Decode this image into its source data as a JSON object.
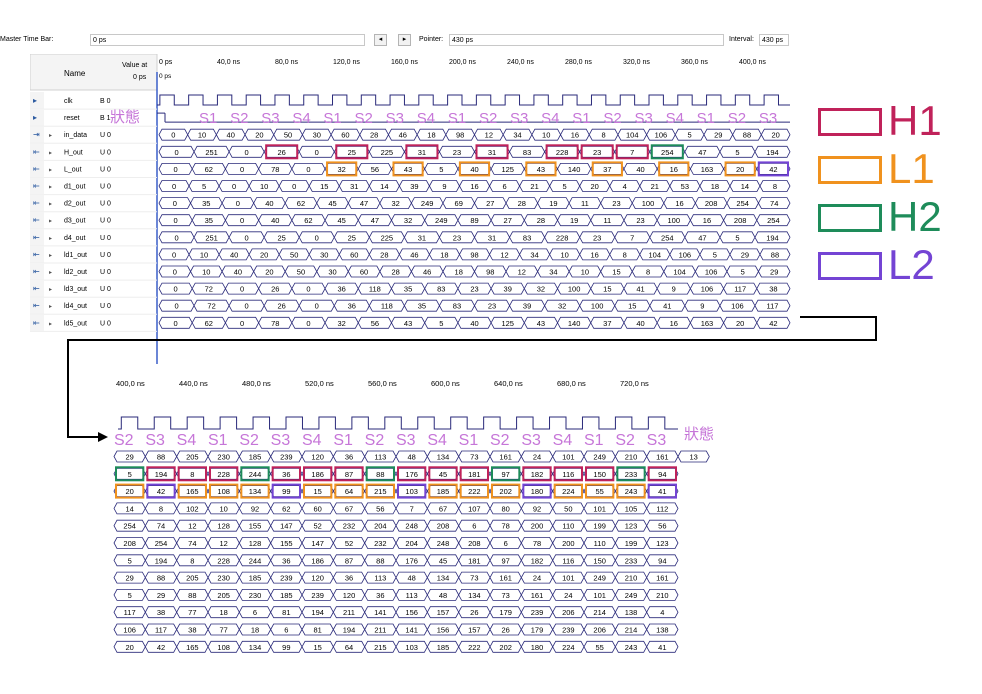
{
  "top_bar": {
    "master_time_bar_label": "Master Time Bar:",
    "master_time_bar_value": "0 ps",
    "pointer_label": "Pointer:",
    "pointer_value": "430 ps",
    "interval_label": "Interval:",
    "interval_value": "430 ps",
    "nav_prev": "◂",
    "nav_next": "▸"
  },
  "main_panel": {
    "name_header": "Name",
    "value_header": "Value at",
    "value_header_sub": "0 ps",
    "cursor_label": "0 ps",
    "time_labels": [
      "0 ps",
      "40,0 ns",
      "80,0 ns",
      "120,0 ns",
      "160,0 ns",
      "200,0 ns",
      "240,0 ns",
      "280,0 ns",
      "320,0 ns",
      "360,0 ns",
      "400,0 ns",
      "4"
    ],
    "signals": [
      {
        "name": "clk",
        "value": "B 0",
        "type": "input",
        "expand": false
      },
      {
        "name": "reset",
        "value": "B 1",
        "type": "input",
        "expand": false
      },
      {
        "name": "in_data",
        "value": "U 0",
        "type": "bus-in",
        "expand": true
      },
      {
        "name": "H_out",
        "value": "U 0",
        "type": "bus-out",
        "expand": true
      },
      {
        "name": "L_out",
        "value": "U 0",
        "type": "bus-out",
        "expand": true
      },
      {
        "name": "d1_out",
        "value": "U 0",
        "type": "bus-out",
        "expand": true
      },
      {
        "name": "d2_out",
        "value": "U 0",
        "type": "bus-out",
        "expand": true
      },
      {
        "name": "d3_out",
        "value": "U 0",
        "type": "bus-out",
        "expand": true
      },
      {
        "name": "d4_out",
        "value": "U 0",
        "type": "bus-out",
        "expand": true
      },
      {
        "name": "ld1_out",
        "value": "U 0",
        "type": "bus-out",
        "expand": true
      },
      {
        "name": "ld2_out",
        "value": "U 0",
        "type": "bus-out",
        "expand": true
      },
      {
        "name": "ld3_out",
        "value": "U 0",
        "type": "bus-out",
        "expand": true
      },
      {
        "name": "ld4_out",
        "value": "U 0",
        "type": "bus-out",
        "expand": true
      },
      {
        "name": "ld5_out",
        "value": "U 0",
        "type": "bus-out",
        "expand": true
      }
    ],
    "state_label_text": "狀態",
    "state_sequence": [
      "S1",
      "S2",
      "S3",
      "S4",
      "S1",
      "S2",
      "S3",
      "S4",
      "S1",
      "S2",
      "S3",
      "S4",
      "S1",
      "S2",
      "S3",
      "S4",
      "S1",
      "S2",
      "S3"
    ],
    "bus_rows": [
      [
        "0",
        "10",
        "40",
        "20",
        "50",
        "30",
        "60",
        "28",
        "46",
        "18",
        "98",
        "12",
        "34",
        "10",
        "16",
        "8",
        "104",
        "106",
        "5",
        "29",
        "88",
        "20"
      ],
      [
        "0",
        "251",
        "0",
        "26",
        "0",
        "25",
        "225",
        "31",
        "23",
        "31",
        "83",
        "228",
        "23",
        "7",
        "254",
        "47",
        "5",
        "194"
      ],
      [
        "0",
        "62",
        "0",
        "78",
        "0",
        "32",
        "56",
        "43",
        "5",
        "40",
        "125",
        "43",
        "140",
        "37",
        "40",
        "16",
        "163",
        "20",
        "42"
      ],
      [
        "0",
        "5",
        "0",
        "10",
        "0",
        "15",
        "31",
        "14",
        "39",
        "9",
        "16",
        "6",
        "21",
        "5",
        "20",
        "4",
        "21",
        "53",
        "18",
        "14",
        "8"
      ],
      [
        "0",
        "35",
        "0",
        "40",
        "62",
        "45",
        "47",
        "32",
        "249",
        "69",
        "27",
        "28",
        "19",
        "11",
        "23",
        "100",
        "16",
        "208",
        "254",
        "74"
      ],
      [
        "0",
        "35",
        "0",
        "40",
        "62",
        "45",
        "47",
        "32",
        "249",
        "89",
        "27",
        "28",
        "19",
        "11",
        "23",
        "100",
        "16",
        "208",
        "254"
      ],
      [
        "0",
        "251",
        "0",
        "25",
        "0",
        "25",
        "225",
        "31",
        "23",
        "31",
        "83",
        "228",
        "23",
        "7",
        "254",
        "47",
        "5",
        "194"
      ],
      [
        "0",
        "10",
        "40",
        "20",
        "50",
        "30",
        "60",
        "28",
        "46",
        "18",
        "98",
        "12",
        "34",
        "10",
        "16",
        "8",
        "104",
        "106",
        "5",
        "29",
        "88"
      ],
      [
        "0",
        "10",
        "40",
        "20",
        "50",
        "30",
        "60",
        "28",
        "46",
        "18",
        "98",
        "12",
        "34",
        "10",
        "15",
        "8",
        "104",
        "106",
        "5",
        "29"
      ],
      [
        "0",
        "72",
        "0",
        "26",
        "0",
        "36",
        "118",
        "35",
        "83",
        "23",
        "39",
        "32",
        "100",
        "15",
        "41",
        "9",
        "106",
        "117",
        "38"
      ],
      [
        "0",
        "72",
        "0",
        "26",
        "0",
        "36",
        "118",
        "35",
        "83",
        "23",
        "39",
        "32",
        "100",
        "15",
        "41",
        "9",
        "106",
        "117"
      ],
      [
        "0",
        "62",
        "0",
        "78",
        "0",
        "32",
        "56",
        "43",
        "5",
        "40",
        "125",
        "43",
        "140",
        "37",
        "40",
        "16",
        "163",
        "20",
        "42"
      ]
    ],
    "h1_highlights": [
      3,
      5,
      7,
      9,
      11,
      12,
      13
    ],
    "l1_highlights": [
      5,
      7,
      9,
      11,
      13,
      15,
      17
    ],
    "h2_highlights": [
      14
    ],
    "l2_highlights": [
      18
    ]
  },
  "zoom_panel": {
    "time_labels": [
      "400,0 ns",
      "440,0 ns",
      "480,0 ns",
      "520,0 ns",
      "560,0 ns",
      "600,0 ns",
      "640,0 ns",
      "680,0 ns",
      "720,0 ns"
    ],
    "state_label_text": "狀態",
    "state_sequence": [
      "S2",
      "S3",
      "S4",
      "S1",
      "S2",
      "S3",
      "S4",
      "S1",
      "S2",
      "S3",
      "S4",
      "S1",
      "S2",
      "S3",
      "S4",
      "S1",
      "S2",
      "S3"
    ],
    "bus_rows": [
      [
        "29",
        "88",
        "205",
        "230",
        "185",
        "239",
        "120",
        "36",
        "113",
        "48",
        "134",
        "73",
        "161",
        "24",
        "101",
        "249",
        "210",
        "161",
        "13"
      ],
      [
        "5",
        "194",
        "8",
        "228",
        "244",
        "36",
        "186",
        "87",
        "88",
        "176",
        "45",
        "181",
        "97",
        "182",
        "116",
        "150",
        "233",
        "94"
      ],
      [
        "20",
        "42",
        "165",
        "108",
        "134",
        "99",
        "15",
        "64",
        "215",
        "103",
        "185",
        "222",
        "202",
        "180",
        "224",
        "55",
        "243",
        "41"
      ],
      [
        "14",
        "8",
        "102",
        "10",
        "92",
        "62",
        "60",
        "67",
        "56",
        "7",
        "67",
        "107",
        "80",
        "92",
        "50",
        "101",
        "105",
        "112"
      ],
      [
        "254",
        "74",
        "12",
        "128",
        "155",
        "147",
        "52",
        "232",
        "204",
        "248",
        "208",
        "6",
        "78",
        "200",
        "110",
        "199",
        "123",
        "56"
      ],
      [
        "208",
        "254",
        "74",
        "12",
        "128",
        "155",
        "147",
        "52",
        "232",
        "204",
        "248",
        "208",
        "6",
        "78",
        "200",
        "110",
        "199",
        "123"
      ],
      [
        "5",
        "194",
        "8",
        "228",
        "244",
        "36",
        "186",
        "87",
        "88",
        "176",
        "45",
        "181",
        "97",
        "182",
        "116",
        "150",
        "233",
        "94"
      ],
      [
        "29",
        "88",
        "205",
        "230",
        "185",
        "239",
        "120",
        "36",
        "113",
        "48",
        "134",
        "73",
        "161",
        "24",
        "101",
        "249",
        "210",
        "161"
      ],
      [
        "5",
        "29",
        "88",
        "205",
        "230",
        "185",
        "239",
        "120",
        "36",
        "113",
        "48",
        "134",
        "73",
        "161",
        "24",
        "101",
        "249",
        "210"
      ],
      [
        "117",
        "38",
        "77",
        "18",
        "6",
        "81",
        "194",
        "211",
        "141",
        "156",
        "157",
        "26",
        "179",
        "239",
        "206",
        "214",
        "138",
        "4"
      ],
      [
        "106",
        "117",
        "38",
        "77",
        "18",
        "6",
        "81",
        "194",
        "211",
        "141",
        "156",
        "157",
        "26",
        "179",
        "239",
        "206",
        "214",
        "138"
      ],
      [
        "20",
        "42",
        "165",
        "108",
        "134",
        "99",
        "15",
        "64",
        "215",
        "103",
        "185",
        "222",
        "202",
        "180",
        "224",
        "55",
        "243",
        "41"
      ]
    ],
    "h_row_colors": [
      "green",
      "red",
      "red",
      "red",
      "green",
      "red",
      "red",
      "red",
      "green",
      "red",
      "red",
      "red",
      "green",
      "red",
      "red",
      "red",
      "green",
      "red"
    ],
    "l_row_colors": [
      "orange",
      "purple",
      "orange",
      "orange",
      "orange",
      "purple",
      "orange",
      "orange",
      "orange",
      "purple",
      "orange",
      "orange",
      "orange",
      "purple",
      "orange",
      "orange",
      "orange",
      "purple"
    ]
  },
  "legend": [
    {
      "label": "H1",
      "color": "#c0225a"
    },
    {
      "label": "L1",
      "color": "#f0921e"
    },
    {
      "label": "H2",
      "color": "#1e8c5a"
    },
    {
      "label": "L2",
      "color": "#7444d4"
    }
  ],
  "colors": {
    "state_text": "#c676d8",
    "waveform_line": "#2a2a7a",
    "h_box": "#c0225a",
    "l_box": "#f0921e",
    "h2_box": "#1e8c5a",
    "l2_box": "#7444d4"
  }
}
